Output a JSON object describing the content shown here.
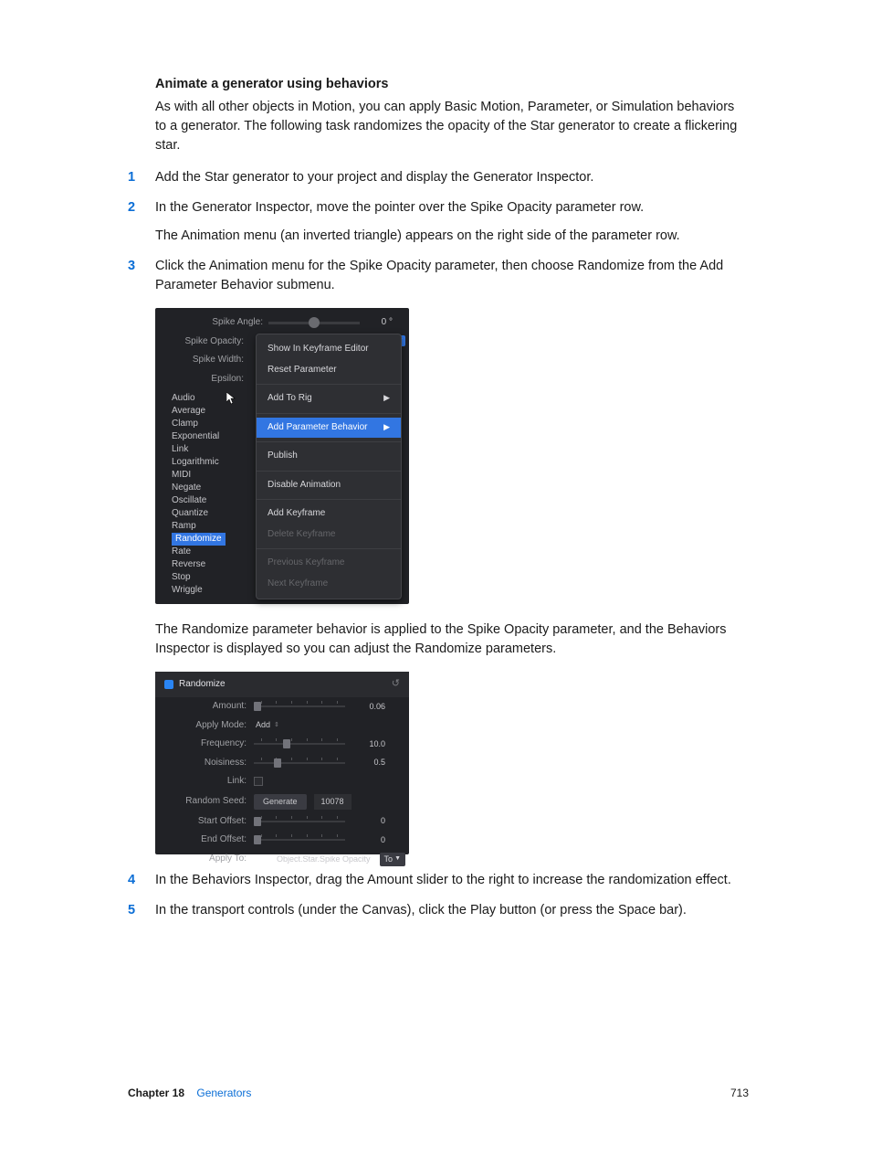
{
  "heading": "Animate a generator using behaviors",
  "intro": "As with all other objects in Motion, you can apply Basic Motion, Parameter, or Simulation behaviors to a generator. The following task randomizes the opacity of the Star generator to create a flickering star.",
  "steps": {
    "s1": "Add the Star generator to your project and display the Generator Inspector.",
    "s2": "In the Generator Inspector, move the pointer over the Spike Opacity parameter row.",
    "s2_sub": "The Animation menu (an inverted triangle) appears on the right side of the parameter row.",
    "s3": "Click the Animation menu for the Spike Opacity parameter, then choose Randomize from the Add Parameter Behavior submenu.",
    "s3_post": "The Randomize parameter behavior is applied to the Spike Opacity parameter, and the Behaviors Inspector is displayed so you can adjust the Randomize parameters.",
    "s4": "In the Behaviors Inspector, drag the Amount slider to the right to increase the randomization effect.",
    "s5": "In the transport controls (under the Canvas), click the Play button (or press the Space bar)."
  },
  "shot1": {
    "params": {
      "angle_label": "Spike Angle:",
      "angle_val": "0 °",
      "opacity_label": "Spike Opacity:",
      "width_label": "Spike Width:",
      "epsilon_label": "Epsilon:"
    },
    "menu": {
      "show_kf": "Show In Keyframe Editor",
      "reset": "Reset Parameter",
      "add_rig": "Add To Rig",
      "add_param": "Add Parameter Behavior",
      "publish": "Publish",
      "disable": "Disable Animation",
      "add_kf": "Add Keyframe",
      "del_kf": "Delete Keyframe",
      "prev_kf": "Previous Keyframe",
      "next_kf": "Next Keyframe"
    },
    "sublist": {
      "i0": "Audio",
      "i1": "Average",
      "i2": "Clamp",
      "i3": "Exponential",
      "i4": "Link",
      "i5": "Logarithmic",
      "i6": "MIDI",
      "i7": "Negate",
      "i8": "Oscillate",
      "i9": "Quantize",
      "i10": "Ramp",
      "i11": "Randomize",
      "i12": "Rate",
      "i13": "Reverse",
      "i14": "Stop",
      "i15": "Wriggle"
    }
  },
  "shot2": {
    "title": "Randomize",
    "rows": {
      "amount_l": "Amount:",
      "amount_v": "0.06",
      "apply_l": "Apply Mode:",
      "apply_v": "Add",
      "freq_l": "Frequency:",
      "freq_v": "10.0",
      "noise_l": "Noisiness:",
      "noise_v": "0.5",
      "link_l": "Link:",
      "seed_l": "Random Seed:",
      "seed_btn": "Generate",
      "seed_v": "10078",
      "start_l": "Start Offset:",
      "start_v": "0",
      "end_l": "End Offset:",
      "end_v": "0",
      "applyto_l": "Apply To:",
      "applyto_v": "Object.Star.Spike Opacity",
      "to": "To"
    }
  },
  "footer": {
    "chapter": "Chapter 18",
    "section": "Generators",
    "page": "713"
  }
}
